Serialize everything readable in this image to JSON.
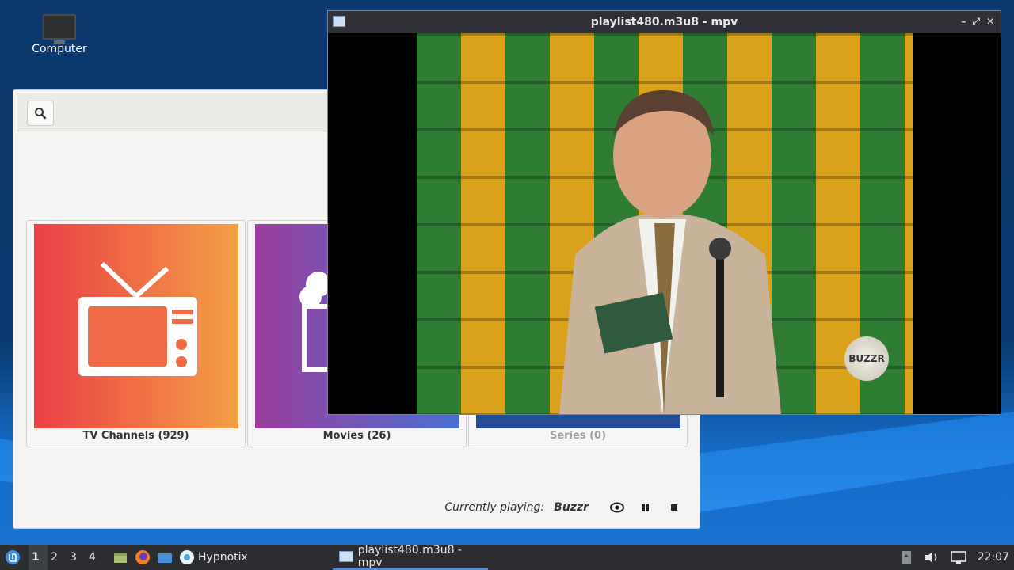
{
  "desktop": {
    "icons": [
      {
        "label": "Computer",
        "icon": "monitor-icon"
      }
    ]
  },
  "hypnotix": {
    "search_icon": "search-icon",
    "cards": [
      {
        "label": "TV Channels (929)",
        "icon": "tv-icon"
      },
      {
        "label": "Movies (26)",
        "icon": "popcorn-icon"
      },
      {
        "label": "Series (0)",
        "icon": "series-icon"
      }
    ],
    "playback": {
      "label": "Currently playing:",
      "channel": "Buzzr",
      "eye_icon": "eye-icon",
      "pause_icon": "pause-icon",
      "stop_icon": "stop-icon"
    },
    "colors": {
      "tv_start": "#ea3e47",
      "tv_end": "#f3a044",
      "movies_start": "#9a3e9c",
      "movies_end": "#4a6fd0",
      "series": "#264c96"
    }
  },
  "mpv": {
    "title": "playlist480.m3u8 - mpv",
    "buttons": [
      "minimize",
      "maximize",
      "close"
    ],
    "watermark": "BUZZR"
  },
  "taskbar": {
    "workspaces": [
      "1",
      "2",
      "3",
      "4"
    ],
    "active_workspace": "1",
    "launchers": [
      "mint-menu-icon",
      "files-icon",
      "firefox-icon",
      "folder-icon"
    ],
    "tasks": [
      {
        "label": "Hypnotix",
        "icon": "hypnotix-icon"
      },
      {
        "label": "playlist480.m3u8 - mpv",
        "icon": "window-icon",
        "active": true
      }
    ],
    "clock": "22:07"
  }
}
